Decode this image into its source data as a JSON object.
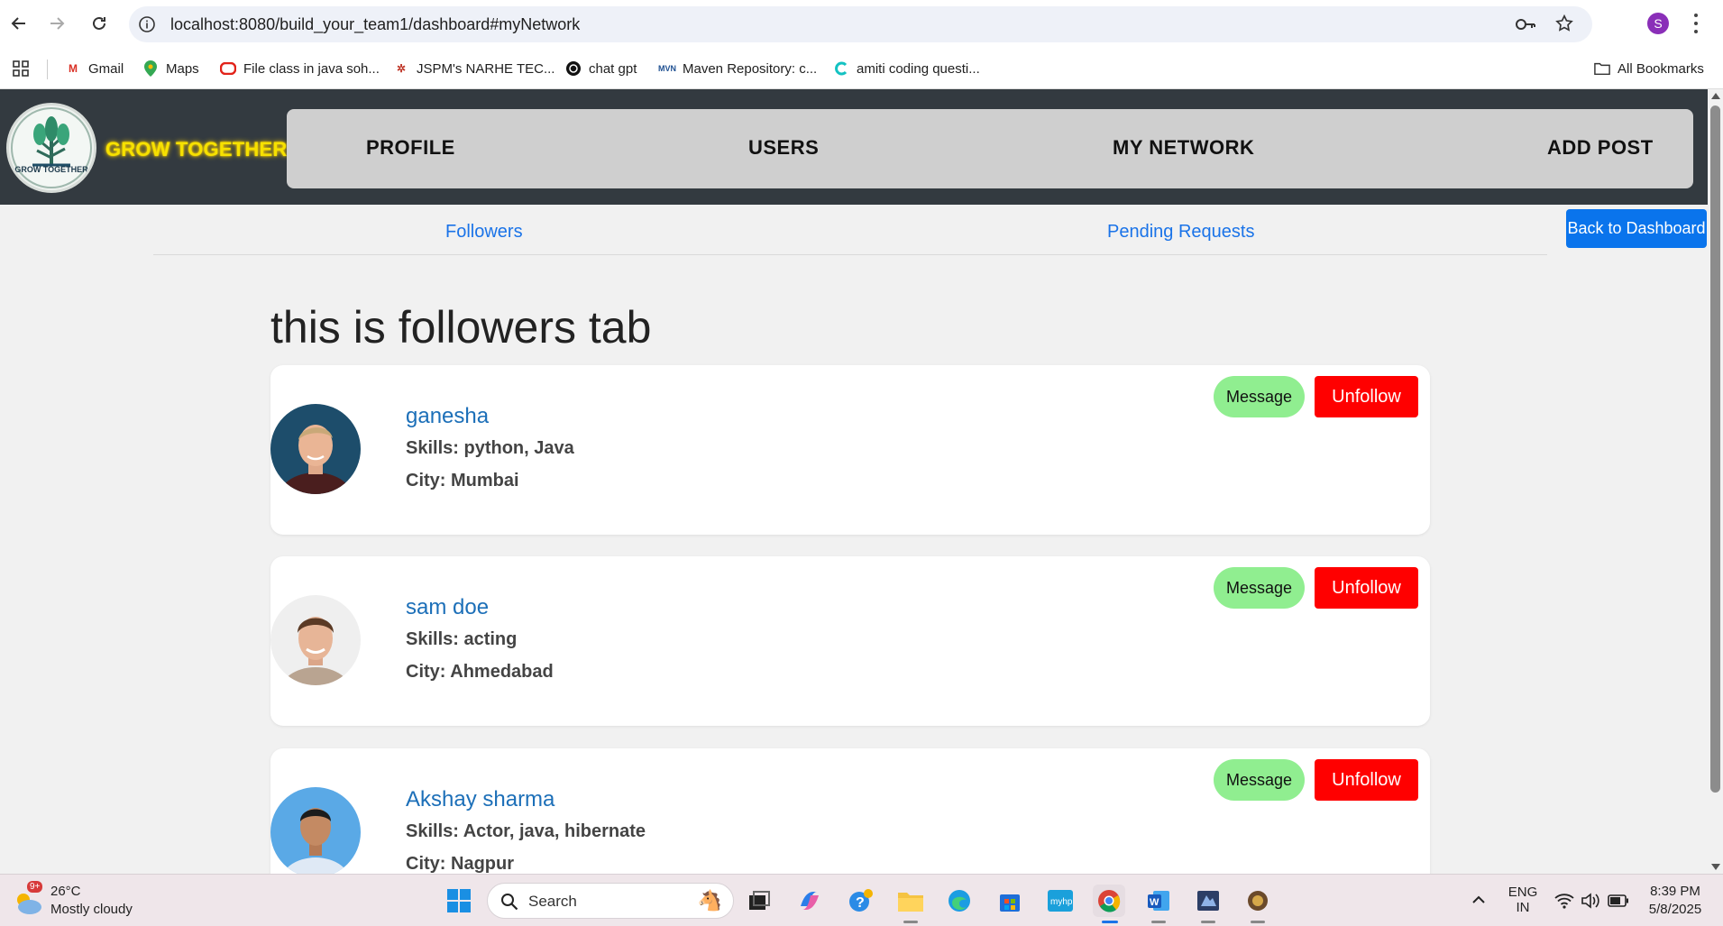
{
  "browser": {
    "url": "localhost:8080/build_your_team1/dashboard#myNetwork",
    "profile_initial": "S",
    "bookmarks": [
      {
        "label": "Gmail"
      },
      {
        "label": "Maps"
      },
      {
        "label": "File class in java soh..."
      },
      {
        "label": "JSPM's NARHE TEC..."
      },
      {
        "label": "chat gpt"
      },
      {
        "label": "Maven Repository: c..."
      },
      {
        "label": "amiti coding questi..."
      }
    ],
    "all_bookmarks_label": "All Bookmarks"
  },
  "header": {
    "logo_text": "GROW TOGETHER",
    "brand": "GROW TOGETHER",
    "menu": [
      {
        "label": "PROFILE"
      },
      {
        "label": "USERS"
      },
      {
        "label": "MY NETWORK"
      },
      {
        "label": "ADD POST"
      }
    ]
  },
  "tabs": {
    "followers": "Followers",
    "pending": "Pending Requests",
    "back": "Back to Dashboard"
  },
  "content": {
    "title": "this is followers tab",
    "message_label": "Message",
    "unfollow_label": "Unfollow",
    "followers": [
      {
        "name": "ganesha",
        "skills": "Skills: python, Java",
        "city": "City: Mumbai"
      },
      {
        "name": "sam doe",
        "skills": "Skills: acting",
        "city": "City: Ahmedabad"
      },
      {
        "name": "Akshay sharma",
        "skills": "Skills: Actor, java, hibernate",
        "city": "City: Nagpur"
      }
    ]
  },
  "taskbar": {
    "weather_badge": "9+",
    "temperature": "26°C",
    "condition": "Mostly cloudy",
    "search_label": "Search",
    "lang_top": "ENG",
    "lang_bottom": "IN",
    "time": "8:39 PM",
    "date": "5/8/2025"
  },
  "colors": {
    "header_bg": "#333a40",
    "brand_yellow": "#f6e100",
    "menu_bg": "#cfcfcf",
    "link_blue": "#1a73e8",
    "primary_button": "#0a74ec",
    "message_green": "#90ee90",
    "unfollow_red": "#ff0000"
  }
}
